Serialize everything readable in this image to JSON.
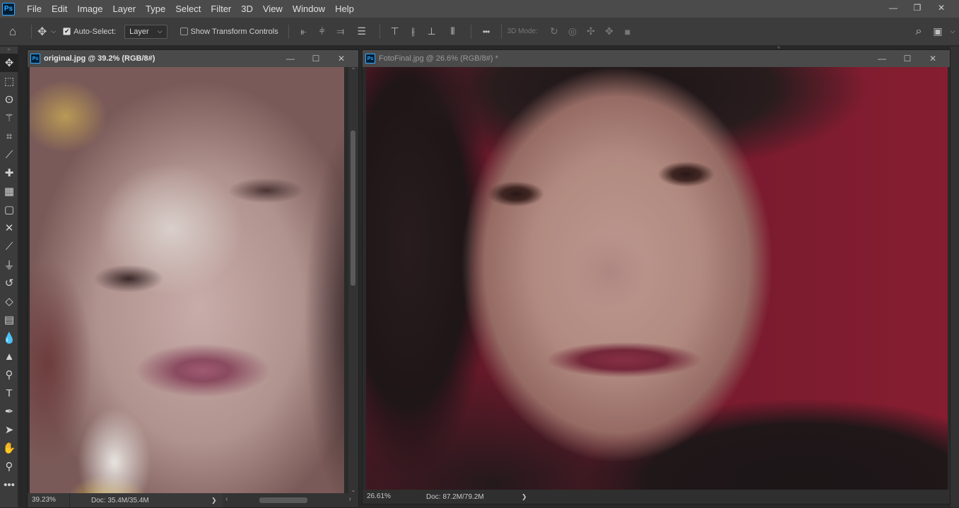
{
  "menubar": {
    "logo": "Ps",
    "items": [
      "File",
      "Edit",
      "Image",
      "Layer",
      "Type",
      "Select",
      "Filter",
      "3D",
      "View",
      "Window",
      "Help"
    ],
    "window_controls": [
      "minimize-icon",
      "restore-icon",
      "close-icon"
    ]
  },
  "options": {
    "auto_select_label": "Auto-Select:",
    "auto_select_checked": true,
    "layer_dropdown": "Layer",
    "show_transform_label": "Show Transform Controls",
    "show_transform_checked": false,
    "mode_3d_label": "3D Mode:",
    "more": "•••"
  },
  "toolbar": {
    "tools": [
      "move-tool-icon",
      "marquee-tool-icon",
      "lasso-tool-icon",
      "magic-wand-icon",
      "crop-tool-icon",
      "eyedropper-icon",
      "healing-brush-icon",
      "patch-tool-icon",
      "frame-tool-icon",
      "content-aware-move-icon",
      "brush-tool-icon",
      "clone-stamp-icon",
      "history-brush-icon",
      "eraser-icon",
      "gradient-tool-icon",
      "blur-tool-icon",
      "sharpen-tool-icon",
      "dodge-tool-icon",
      "type-tool-icon",
      "pen-tool-icon",
      "path-selection-icon",
      "hand-tool-icon",
      "zoom-tool-icon",
      "more-tools-icon"
    ]
  },
  "doc_left": {
    "logo": "Ps",
    "title": "original.jpg @ 39.2% (RGB/8#)",
    "zoom": "39.23%",
    "doc_size": "Doc: 35.4M/35.4M",
    "arrow": "❯"
  },
  "doc_right": {
    "logo": "Ps",
    "title": "FotoFinal.jpg @ 26.6% (RGB/8#) *",
    "zoom": "26.61%",
    "doc_size": "Doc: 87.2M/79.2M",
    "arrow": "❯"
  },
  "colors": {
    "menubar": "#4b4b4b",
    "options": "#3c3c3c",
    "accent": "#31a8ff"
  }
}
